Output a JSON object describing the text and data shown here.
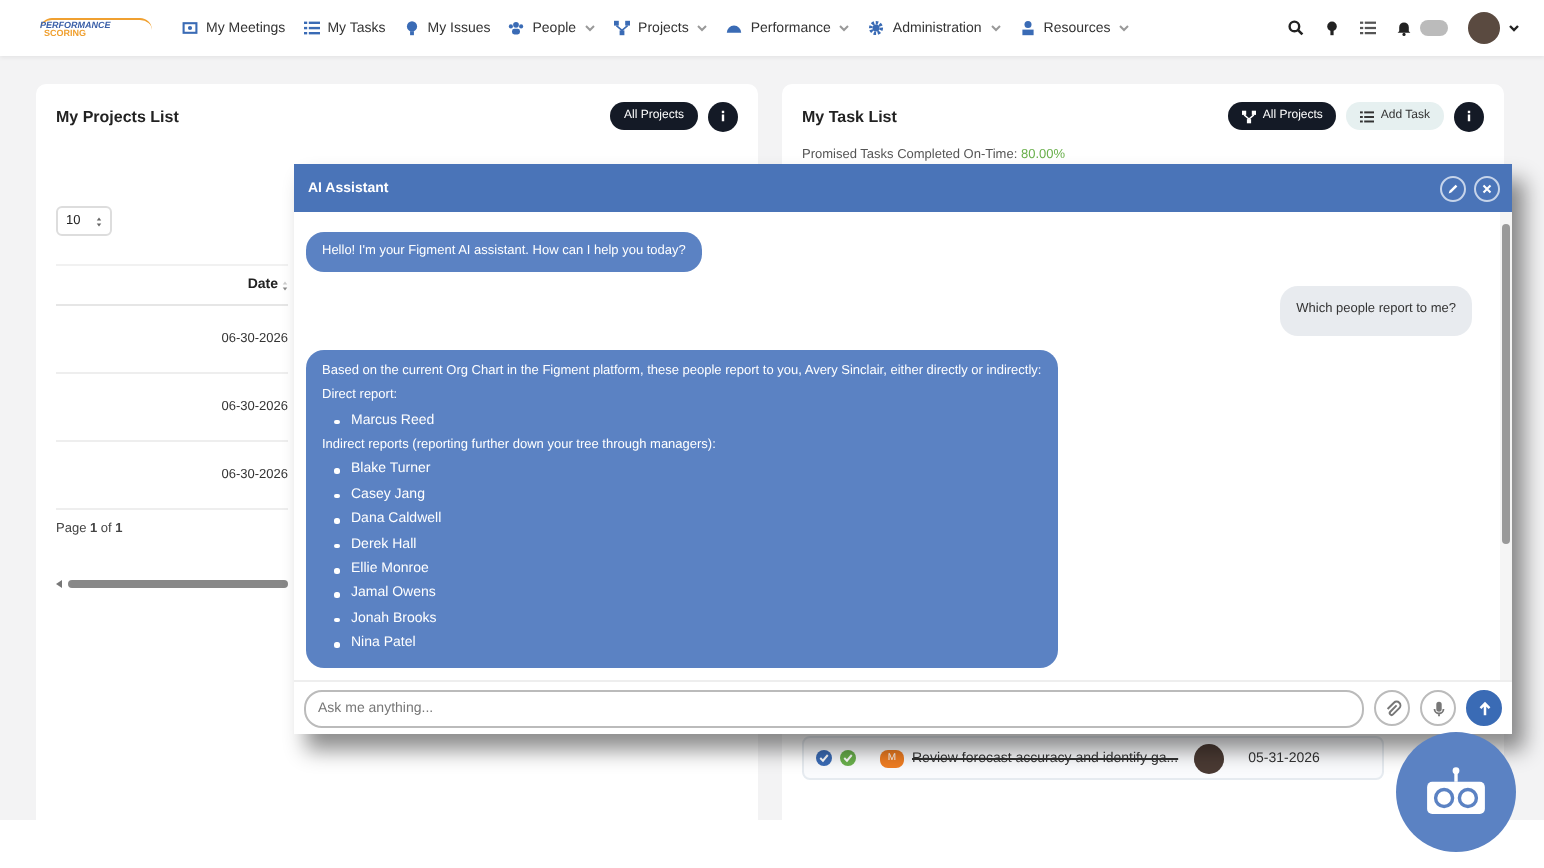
{
  "nav": {
    "logo": {
      "top": "PERFORMANCE",
      "bottom": "SCORING"
    },
    "items": [
      {
        "label": "My Meetings",
        "dropdown": false
      },
      {
        "label": "My Tasks",
        "dropdown": false
      },
      {
        "label": "My Issues",
        "dropdown": false
      },
      {
        "label": "People",
        "dropdown": true
      },
      {
        "label": "Projects",
        "dropdown": true
      },
      {
        "label": "Performance",
        "dropdown": true
      },
      {
        "label": "Administration",
        "dropdown": true
      },
      {
        "label": "Resources",
        "dropdown": true
      }
    ]
  },
  "projects": {
    "title": "My Projects List",
    "filter_button": "All Projects",
    "page_size": "10",
    "columns": [
      {
        "label": "Date",
        "sorted": true
      }
    ],
    "rows": [
      "06-30-2026",
      "06-30-2026",
      "06-30-2026"
    ],
    "pager": "Page **1** of **1**"
  },
  "tasks": {
    "title": "My Task List",
    "buttons": [
      {
        "label": "All Projects",
        "kind": "dark"
      },
      {
        "label": "Add Task",
        "kind": "light"
      }
    ],
    "stat_label": "Promised Tasks Completed On-Time:",
    "stat_value": "80.00%",
    "rows": [
      {
        "checked": true,
        "done": true,
        "badge": "M",
        "text": "Review forecast accuracy and identify ga...",
        "date": "05-31-2026"
      }
    ]
  },
  "chat": {
    "title": "AI Assistant",
    "messages": [
      {
        "kind": "assistant",
        "blocks": [
          {
            "kind": "p",
            "text": "Hello! I'm your Figment AI assistant. How can I help you today?"
          }
        ]
      },
      {
        "kind": "user",
        "blocks": [
          {
            "kind": "p",
            "text": "Which people report to me?"
          }
        ]
      },
      {
        "kind": "assistant",
        "blocks": [
          {
            "kind": "p",
            "text": "Based on the current Org Chart in the Figment platform, these people report to you, Avery Sinclair, either directly or indirectly:"
          },
          {
            "kind": "p",
            "text": "Direct report:"
          },
          {
            "kind": "list",
            "items": [
              "Marcus Reed"
            ]
          },
          {
            "kind": "p",
            "text": "Indirect reports (reporting further down your tree through managers):"
          },
          {
            "kind": "list",
            "items": [
              "Blake Turner",
              "Casey Jang",
              "Dana Caldwell",
              "Derek Hall",
              "Ellie Monroe",
              "Jamal Owens",
              "Jonah Brooks",
              "Nina Patel"
            ]
          }
        ]
      }
    ],
    "input": {
      "placeholder": "Ask me anything..."
    }
  }
}
